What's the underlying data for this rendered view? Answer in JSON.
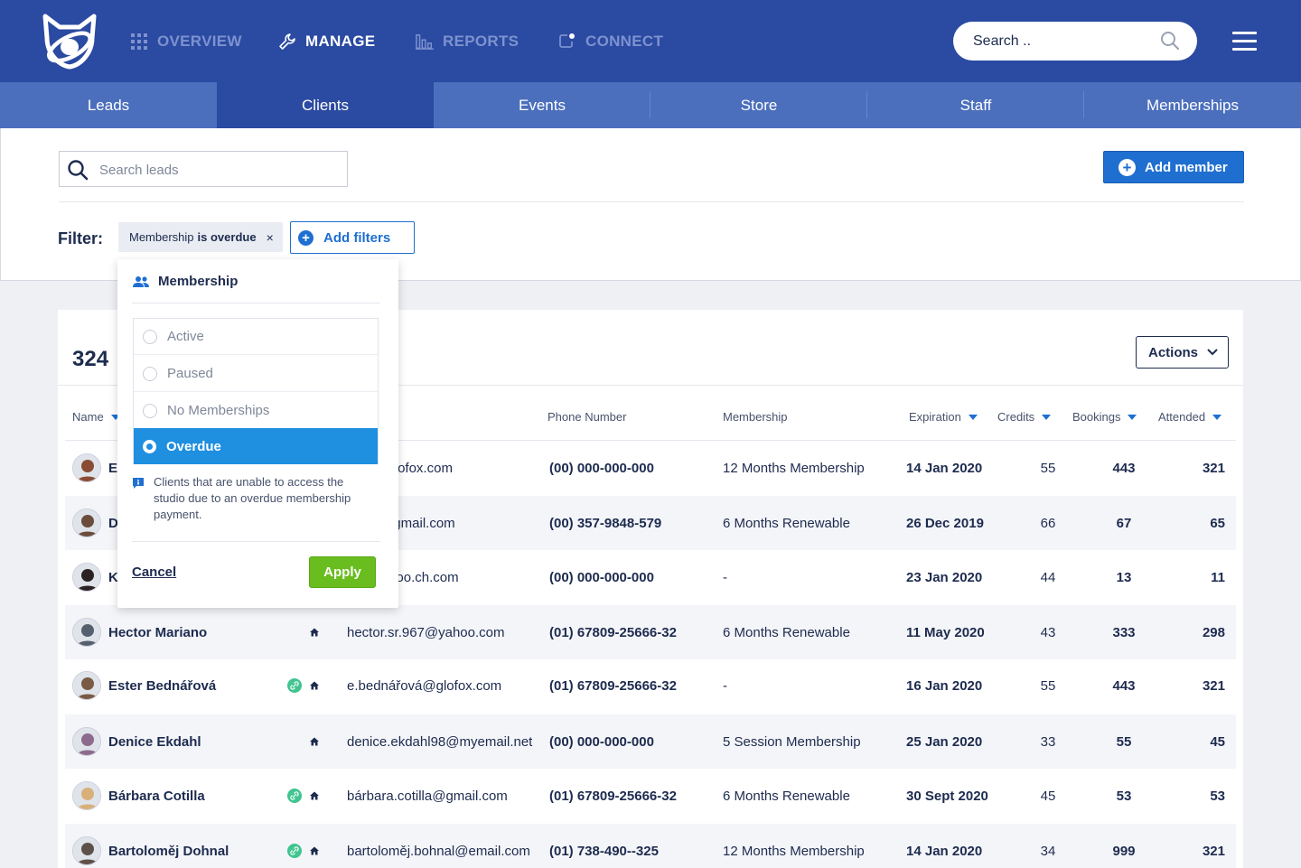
{
  "nav": {
    "items": [
      {
        "label": "OVERVIEW",
        "icon": "grid-icon",
        "active": false
      },
      {
        "label": "MANAGE",
        "icon": "wrench-icon",
        "active": true
      },
      {
        "label": "REPORTS",
        "icon": "bar-chart-icon",
        "active": false
      },
      {
        "label": "CONNECT",
        "icon": "chat-icon",
        "active": false
      }
    ],
    "search_placeholder": "Search .."
  },
  "tabs": [
    "Leads",
    "Clients",
    "Events",
    "Store",
    "Staff",
    "Memberships"
  ],
  "active_tab": "Clients",
  "filters": {
    "search_placeholder": "Search leads",
    "add_member_label": "Add member",
    "filter_label": "Filter:",
    "chip_prefix": "Membership",
    "chip_value": "is overdue",
    "chip_remove": "×",
    "add_filters_label": "Add filters"
  },
  "dropdown": {
    "title": "Membership",
    "options": [
      {
        "label": "Active",
        "selected": false
      },
      {
        "label": "Paused",
        "selected": false
      },
      {
        "label": "No Memberships",
        "selected": false
      },
      {
        "label": "Overdue",
        "selected": true
      }
    ],
    "note": "Clients that are unable to access the studio due to an overdue membership payment.",
    "cancel_label": "Cancel",
    "apply_label": "Apply"
  },
  "table": {
    "count": "324",
    "actions_label": "Actions",
    "headers": {
      "name": "Name",
      "phone": "Phone Number",
      "membership": "Membership",
      "expiration": "Expiration",
      "credits": "Credits",
      "bookings": "Bookings",
      "attended": "Attended"
    },
    "rows": [
      {
        "name": "E",
        "email": "řová@glofox.com",
        "phone": "(00) 000-000-000",
        "membership": "12 Months Membership",
        "expiration": "14 Jan 2020",
        "credits": "55",
        "bookings": "443",
        "attended": "321",
        "tag": false,
        "home": false,
        "avatar_color": "#8a4b34"
      },
      {
        "name": "D",
        "email": "e.d@@gmail.com",
        "phone": "(00) 357-9848-579",
        "membership": "6 Months Renewable",
        "expiration": "26 Dec 2019",
        "credits": "66",
        "bookings": "67",
        "attended": "65",
        "tag": false,
        "home": false,
        "avatar_color": "#6b4c3b"
      },
      {
        "name": "K",
        "email": "n@yololoo.ch.com",
        "phone": "(00) 000-000-000",
        "membership": "-",
        "expiration": "23 Jan 2020",
        "credits": "44",
        "bookings": "13",
        "attended": "11",
        "tag": false,
        "home": false,
        "avatar_color": "#2a2223"
      },
      {
        "name": "Hector Mariano",
        "email": "hector.sr.967@yahoo.com",
        "phone": "(01) 67809-25666-32",
        "membership": "6 Months Renewable",
        "expiration": "11 May 2020",
        "credits": "43",
        "bookings": "333",
        "attended": "298",
        "tag": false,
        "home": true,
        "avatar_color": "#55606f"
      },
      {
        "name": "Ester Bednářová",
        "email": "e.bednářová@glofox.com",
        "phone": "(01) 67809-25666-32",
        "membership": "-",
        "expiration": "16 Jan 2020",
        "credits": "55",
        "bookings": "443",
        "attended": "321",
        "tag": true,
        "home": true,
        "avatar_color": "#7a5a44"
      },
      {
        "name": "Denice Ekdahl",
        "email": "denice.ekdahl98@myemail.net",
        "phone": "(00) 000-000-000",
        "membership": "5 Session Membership",
        "expiration": "25 Jan 2020",
        "credits": "33",
        "bookings": "55",
        "attended": "45",
        "tag": false,
        "home": true,
        "avatar_color": "#8c6a8c"
      },
      {
        "name": "Bárbara Cotilla",
        "email": "bárbara.cotilla@gmail.com",
        "phone": "(01) 67809-25666-32",
        "membership": "6 Months Renewable",
        "expiration": "30 Sept 2020",
        "credits": "45",
        "bookings": "53",
        "attended": "53",
        "tag": true,
        "home": true,
        "avatar_color": "#d8b07a"
      },
      {
        "name": "Bartoloměj Dohnal",
        "email": "bartoloměj.bohnal@email.com",
        "phone": "(01) 738-490--325",
        "membership": "12 Months Membership",
        "expiration": "14 Jan 2020",
        "credits": "34",
        "bookings": "999",
        "attended": "321",
        "tag": true,
        "home": true,
        "avatar_color": "#5d5048"
      }
    ]
  },
  "colors": {
    "topbar": "#2b4aa1",
    "tabs": "#4b6fbd",
    "primary": "#1f6fd1",
    "apply": "#69bd1e",
    "selected": "#1f8fe0"
  }
}
